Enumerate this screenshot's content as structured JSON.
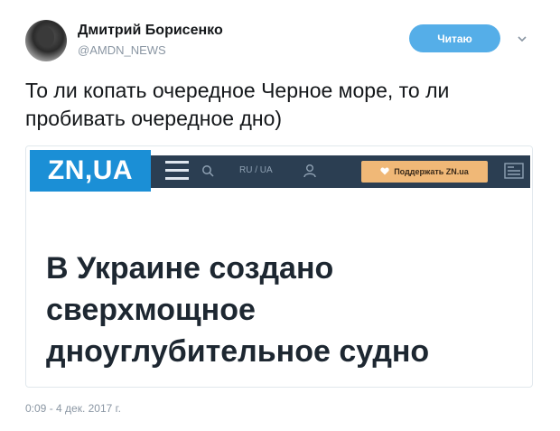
{
  "author": {
    "name": "Дмитрий Борисенко",
    "handle": "@AMDN_NEWS"
  },
  "follow_button": {
    "label": "Читаю"
  },
  "tweet_text": "То ли копать очередное Черное море, то ли пробивать очередное дно)",
  "media": {
    "logo": "ZN,UA",
    "lang": "RU / UA",
    "support_label": "Поддержать ZN.ua",
    "headline": "В Украине создано сверхмощное дноуглубительное судно",
    "colors": {
      "logo_bg": "#1b8fd6",
      "nav_bg": "#2b3e52",
      "support_bg": "#f0b877"
    }
  },
  "timestamp": "0:09 - 4 дек. 2017 г.",
  "colors": {
    "accent": "#55aee8",
    "muted": "#8a96a3"
  }
}
